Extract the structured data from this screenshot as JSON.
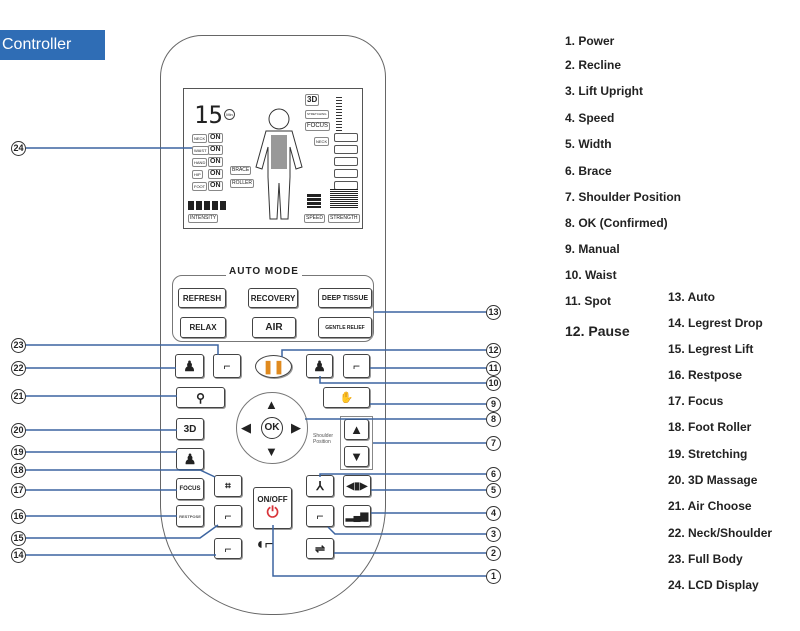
{
  "title": "Controller",
  "lcd": {
    "timer": "15",
    "timer_unit": "Min",
    "body_parts": [
      {
        "part": "NECK",
        "state": "ON"
      },
      {
        "part": "WAIST",
        "state": "ON"
      },
      {
        "part": "HAND",
        "state": "ON"
      },
      {
        "part": "HIP",
        "state": "ON"
      },
      {
        "part": "FOOT",
        "state": "ON"
      }
    ],
    "brace": "BRACE",
    "roller": "ROLLER",
    "mode_3d": "3D",
    "stretching": "STRETCHING",
    "focus": "FOCUS",
    "neck": "NECK",
    "intensity": "INTENSITY",
    "speed": "SPEED",
    "strength": "STRENGTH"
  },
  "auto_mode": {
    "label": "AUTO MODE",
    "buttons": [
      "REFRESH",
      "RECOVERY",
      "DEEP TISSUE",
      "RELAX",
      "AIR",
      "GENTLE RELIEF"
    ]
  },
  "buttons": {
    "ok": "OK",
    "btn_3d": "3D",
    "focus": "FOCUS",
    "restpose": "RESTPOSE",
    "onoff": "ON/OFF",
    "shoulder": "Shoulder Position"
  },
  "callouts_left": [
    "24",
    "23",
    "22",
    "21",
    "20",
    "19",
    "18",
    "17",
    "16",
    "15",
    "14"
  ],
  "callouts_right": [
    "13",
    "12",
    "11",
    "10",
    "9",
    "8",
    "7",
    "6",
    "5",
    "4",
    "3",
    "2",
    "1"
  ],
  "legend_col1": [
    "1.  Power",
    "2.  Recline",
    "3.  Lift Upright",
    "4.  Speed",
    "5.  Width",
    "6.   Brace",
    "7.  Shoulder Position",
    "8.  OK (Confirmed)",
    "9.  Manual",
    "10. Waist",
    "11. Spot",
    "12. Pause"
  ],
  "legend_col2": [
    "13.  Auto",
    "14.  Legrest Drop",
    "15.  Legrest Lift",
    "16.  Restpose",
    "17.  Focus",
    "18.   Foot Roller",
    "19.  Stretching",
    "20.  3D Massage",
    "21.  Air Choose",
    "22.  Neck/Shoulder",
    "23.  Full Body",
    "24.  LCD Display"
  ],
  "colors": {
    "title_bg": "#2f6db5",
    "callout_line": "#3b64a0",
    "pause": "#e08a1e",
    "power": "#d8343a"
  }
}
